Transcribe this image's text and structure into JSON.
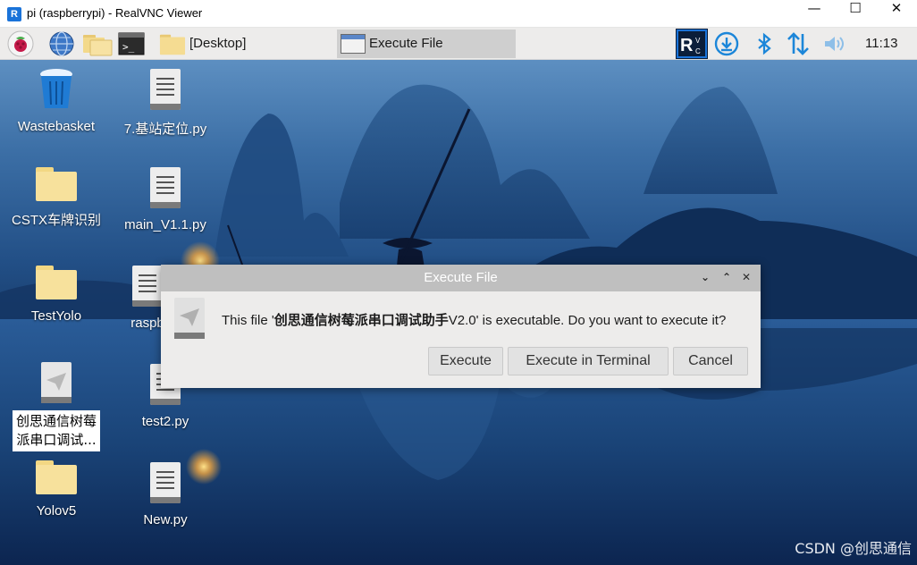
{
  "window": {
    "title": "pi (raspberrypi) - RealVNC Viewer",
    "app_icon": "realvnc-icon",
    "controls": {
      "minimize": "—",
      "maximize": "☐",
      "close": "✕"
    }
  },
  "panel": {
    "icons": [
      "raspberry-menu-icon",
      "web-browser-icon",
      "file-manager-icon",
      "terminal-icon"
    ],
    "folder_button": {
      "label": "[Desktop]",
      "icon": "folder-icon"
    },
    "task_button": {
      "label": "Execute File",
      "icon": "window-icon"
    },
    "tray": [
      "vnc-server-icon",
      "download-icon",
      "bluetooth-icon",
      "network-transfer-icon",
      "volume-icon"
    ],
    "clock": "11:13",
    "accent": "#1a73d9"
  },
  "desktop": {
    "icons": [
      {
        "label": "Wastebasket",
        "type": "trash"
      },
      {
        "label": "7.基站定位.py",
        "type": "document"
      },
      {
        "label": "CSTX车牌识别",
        "type": "folder"
      },
      {
        "label": "main_V1.1.py",
        "type": "document"
      },
      {
        "label": "TestYolo",
        "type": "folder"
      },
      {
        "label": "raspb",
        "type": "document"
      },
      {
        "label_line1": "创思通信树莓",
        "label_line2": "派串口调试...",
        "type": "executable"
      },
      {
        "label": "test2.py",
        "type": "document"
      },
      {
        "label": "Yolov5",
        "type": "folder"
      },
      {
        "label": "New.py",
        "type": "document"
      }
    ],
    "watermark": "CSDN @创思通信"
  },
  "dialog": {
    "title": "Execute File",
    "controls": {
      "minimize": "⌄",
      "maximize": "⌃",
      "close": "✕"
    },
    "message_prefix": "This file '",
    "message_filename": "创思通信树莓派串口调试助手",
    "message_suffix": "V2.0' is executable. Do you want to execute it?",
    "buttons": {
      "execute": "Execute",
      "execute_terminal": "Execute in Terminal",
      "cancel": "Cancel"
    }
  }
}
